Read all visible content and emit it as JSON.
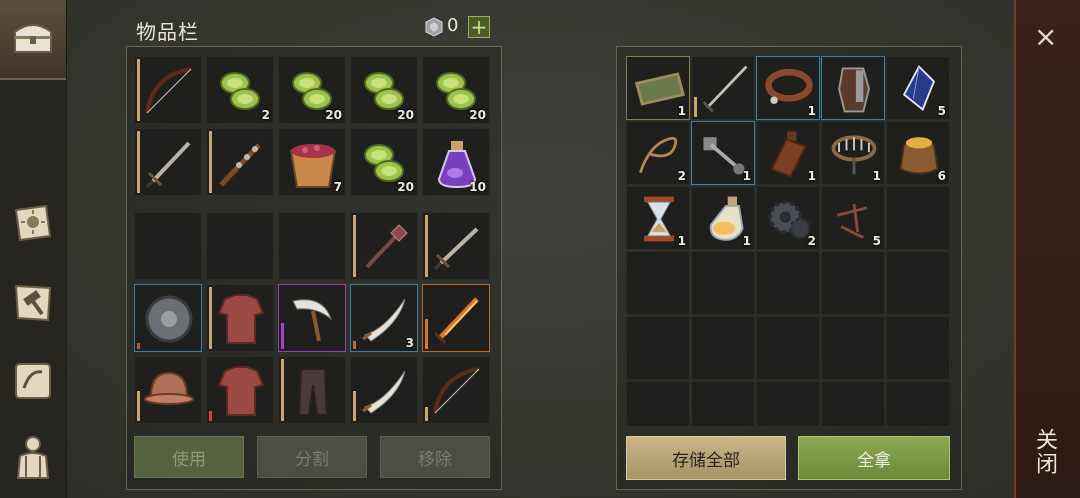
{
  "sidebar": {
    "items": [
      {
        "icon": "chest-icon",
        "active": true
      },
      {
        "icon": "sun-book-icon"
      },
      {
        "icon": "hammer-icon"
      },
      {
        "icon": "scroll-icon"
      },
      {
        "icon": "character-icon"
      }
    ]
  },
  "inventory": {
    "title": "物品栏",
    "currency": "0",
    "plus": "+",
    "top_slots": [
      {
        "icon": "bow-icon",
        "qty": ""
      },
      {
        "icon": "cactus-slices-icon",
        "qty": "2"
      },
      {
        "icon": "cactus-slices-icon",
        "qty": "20"
      },
      {
        "icon": "cactus-slices-icon",
        "qty": "20"
      },
      {
        "icon": "cactus-slices-icon",
        "qty": "20"
      },
      {
        "icon": "sword-icon",
        "qty": ""
      },
      {
        "icon": "spiked-club-icon",
        "qty": ""
      },
      {
        "icon": "berry-bucket-icon",
        "qty": "7"
      },
      {
        "icon": "cactus-slices-icon",
        "qty": "20"
      },
      {
        "icon": "potion-icon",
        "qty": "10"
      }
    ],
    "equip_slots": [
      {
        "icon": "",
        "qty": ""
      },
      {
        "icon": "",
        "qty": ""
      },
      {
        "icon": "",
        "qty": ""
      },
      {
        "icon": "mace-icon",
        "qty": ""
      },
      {
        "icon": "sword-icon",
        "qty": ""
      },
      {
        "icon": "round-shield-icon",
        "qty": ""
      },
      {
        "icon": "chainmail-icon",
        "qty": ""
      },
      {
        "icon": "scythe-icon",
        "qty": ""
      },
      {
        "icon": "scimitar-icon",
        "qty": "3"
      },
      {
        "icon": "flame-sword-icon",
        "qty": ""
      },
      {
        "icon": "helmet-icon",
        "qty": ""
      },
      {
        "icon": "chainmail-icon",
        "qty": ""
      },
      {
        "icon": "pants-icon",
        "qty": ""
      },
      {
        "icon": "scimitar-icon",
        "qty": ""
      },
      {
        "icon": "bow-icon",
        "qty": ""
      }
    ],
    "buttons": {
      "use": "使用",
      "split": "分割",
      "remove": "移除"
    }
  },
  "storage": {
    "slots": [
      {
        "icon": "tray-icon",
        "qty": "1"
      },
      {
        "icon": "sword-icon",
        "qty": ""
      },
      {
        "icon": "collar-icon",
        "qty": "1"
      },
      {
        "icon": "gauntlet-icon",
        "qty": ""
      },
      {
        "icon": "crystal-icon",
        "qty": "5"
      },
      {
        "icon": "rope-icon",
        "qty": "2"
      },
      {
        "icon": "crank-icon",
        "qty": "1"
      },
      {
        "icon": "bottle-icon",
        "qty": "1"
      },
      {
        "icon": "trap-icon",
        "qty": "1"
      },
      {
        "icon": "grain-sack-icon",
        "qty": "6"
      },
      {
        "icon": "hourglass-icon",
        "qty": "1"
      },
      {
        "icon": "potion-flask-icon",
        "qty": "1"
      },
      {
        "icon": "gear-icon",
        "qty": "2"
      },
      {
        "icon": "nails-icon",
        "qty": "5"
      }
    ],
    "buttons": {
      "store_all": "存储全部",
      "take_all": "全拿"
    }
  },
  "close": {
    "x": "×",
    "label": "关闭"
  },
  "colors": {
    "rare": "#3f7ea0",
    "epic": "#9a3fb0",
    "legendary": "#c2681e",
    "take_all": "#8ea854",
    "store_all": "#c9b588"
  }
}
